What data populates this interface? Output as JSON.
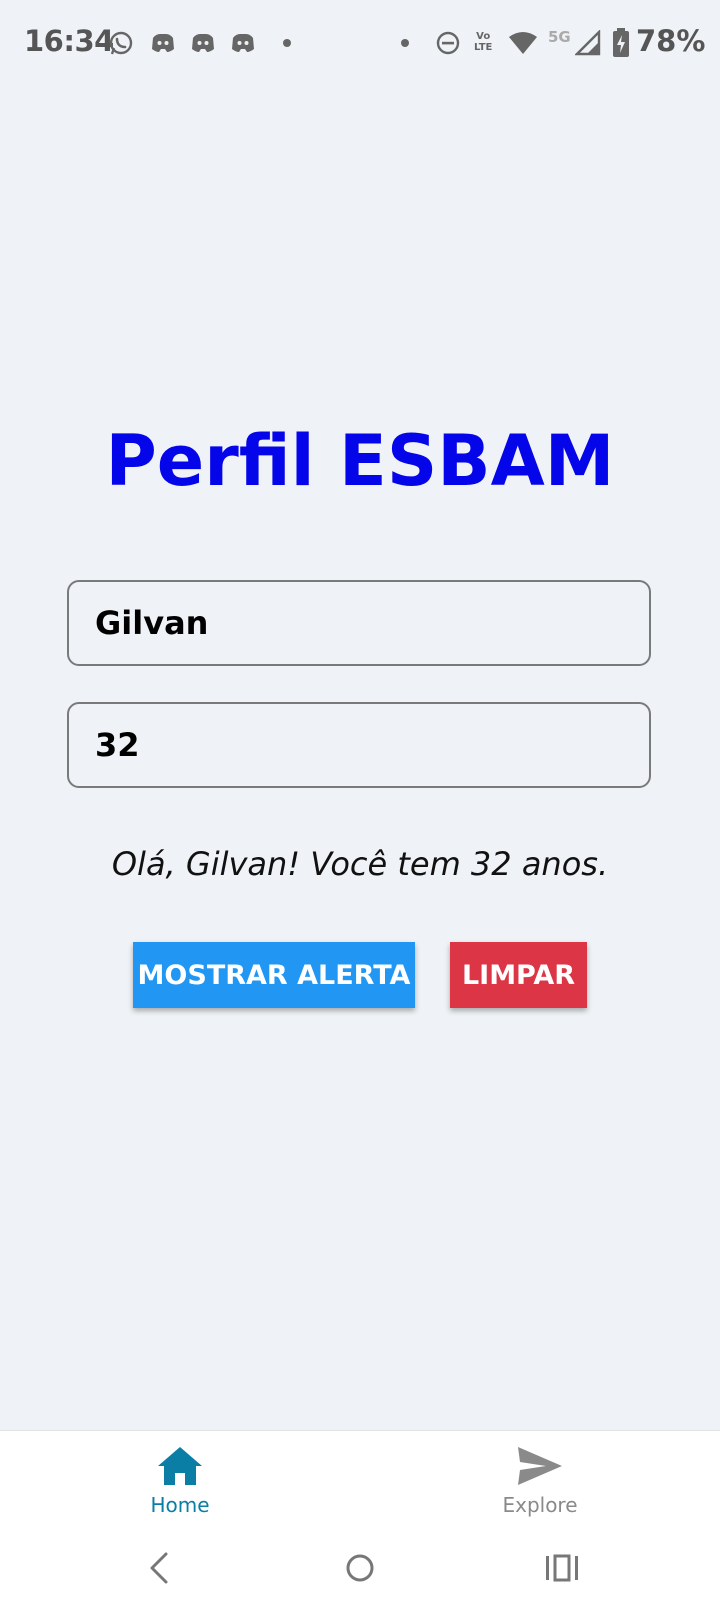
{
  "status_bar": {
    "time": "16:34",
    "network": "5G",
    "volte_top": "Vo",
    "volte_bottom": "LTE",
    "battery": "78%",
    "icons": [
      "whatsapp-icon",
      "discord-icon",
      "discord-icon",
      "discord-icon",
      "dot-icon",
      "dot-icon",
      "do-not-disturb-icon",
      "volte-icon",
      "wifi-icon",
      "signal-icon",
      "battery-charging-icon"
    ]
  },
  "main": {
    "title": "Perfil ESBAM",
    "name_input": {
      "value": "Gilvan"
    },
    "age_input": {
      "value": "32"
    },
    "greeting": "Olá, Gilvan! Você tem 32 anos.",
    "alert_button": "MOSTRAR ALERTA",
    "clear_button": "LIMPAR"
  },
  "tab_bar": {
    "tabs": [
      {
        "label": "Home",
        "icon": "home-icon",
        "active": true
      },
      {
        "label": "Explore",
        "icon": "send-icon",
        "active": false
      }
    ]
  },
  "system_nav": {
    "buttons": [
      "back-icon",
      "home-circle-icon",
      "recents-icon"
    ]
  },
  "colors": {
    "background": "#eff2f6",
    "title": "#0505ea",
    "alert_button": "#2196f3",
    "clear_button": "#dc3545",
    "tab_active": "#0a7ea4",
    "tab_inactive": "#8a8a8a"
  }
}
